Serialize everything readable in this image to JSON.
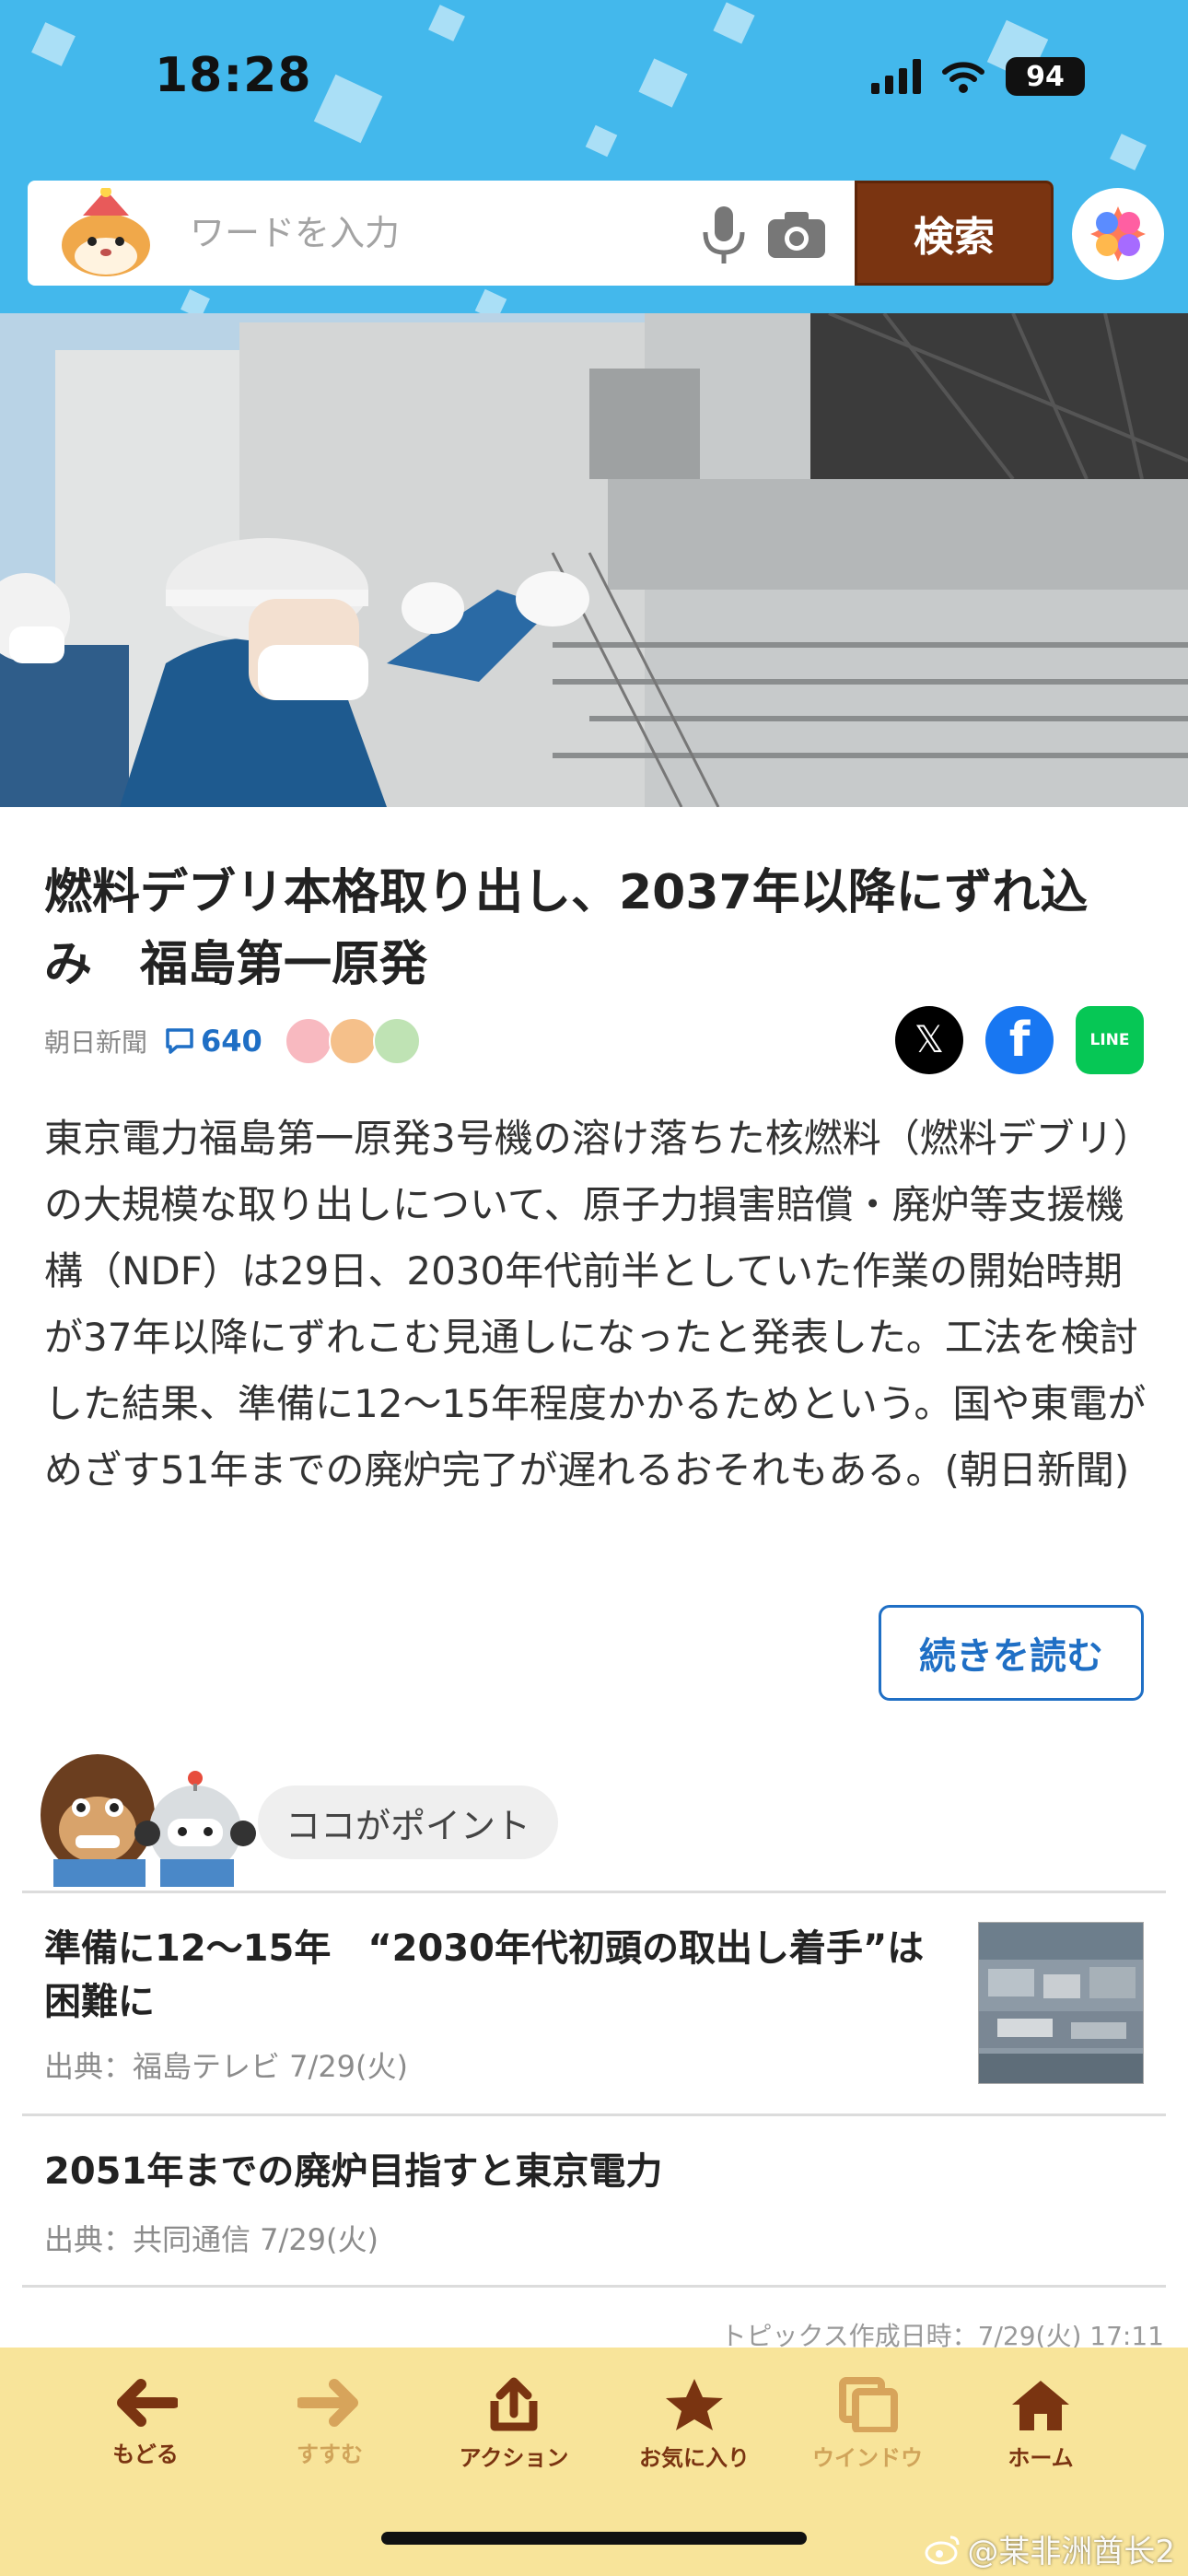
{
  "status_bar": {
    "time": "18:28",
    "battery": "94"
  },
  "search": {
    "placeholder": "ワードを入力",
    "button_label": "検索"
  },
  "article": {
    "title": "燃料デブリ本格取り出し、2037年以降にずれ込み　福島第一原発",
    "source": "朝日新聞",
    "comment_count": "640",
    "body": "東京電力福島第一原発3号機の溶け落ちた核燃料（燃料デブリ）の大規模な取り出しについて、原子力損害賠償・廃炉等支援機構（NDF）は29日、2030年代前半としていた作業の開始時期が37年以降にずれこむ見通しになったと発表した。工法を検討した結果、準備に12〜15年程度かかるためという。国や東電がめざす51年までの廃炉完了が遅れるおそれもある。(朝日新聞)",
    "read_more": "続きを読む"
  },
  "share": {
    "x": "𝕏",
    "facebook": "f",
    "line": "LINE"
  },
  "points": {
    "label": "ココがポイント",
    "items": [
      {
        "title": "準備に12〜15年　“2030年代初頭の取出し着手”は困難に",
        "meta": "出典：福島テレビ 7/29(火)"
      },
      {
        "title": "2051年までの廃炉目指すと東京電力",
        "meta": "出典：共同通信 7/29(火)"
      }
    ],
    "created": "トピックス作成日時：7/29(火) 17:11"
  },
  "toolbar": {
    "back": "もどる",
    "forward": "すすむ",
    "action": "アクション",
    "favorite": "お気に入り",
    "window": "ウインドウ",
    "home": "ホーム"
  },
  "watermark": "@某非洲酋长2",
  "colors": {
    "header_bg": "#43b8ec",
    "search_button": "#7a3411",
    "link": "#1f6fc5",
    "toolbar_bg": "#f8e49a"
  }
}
